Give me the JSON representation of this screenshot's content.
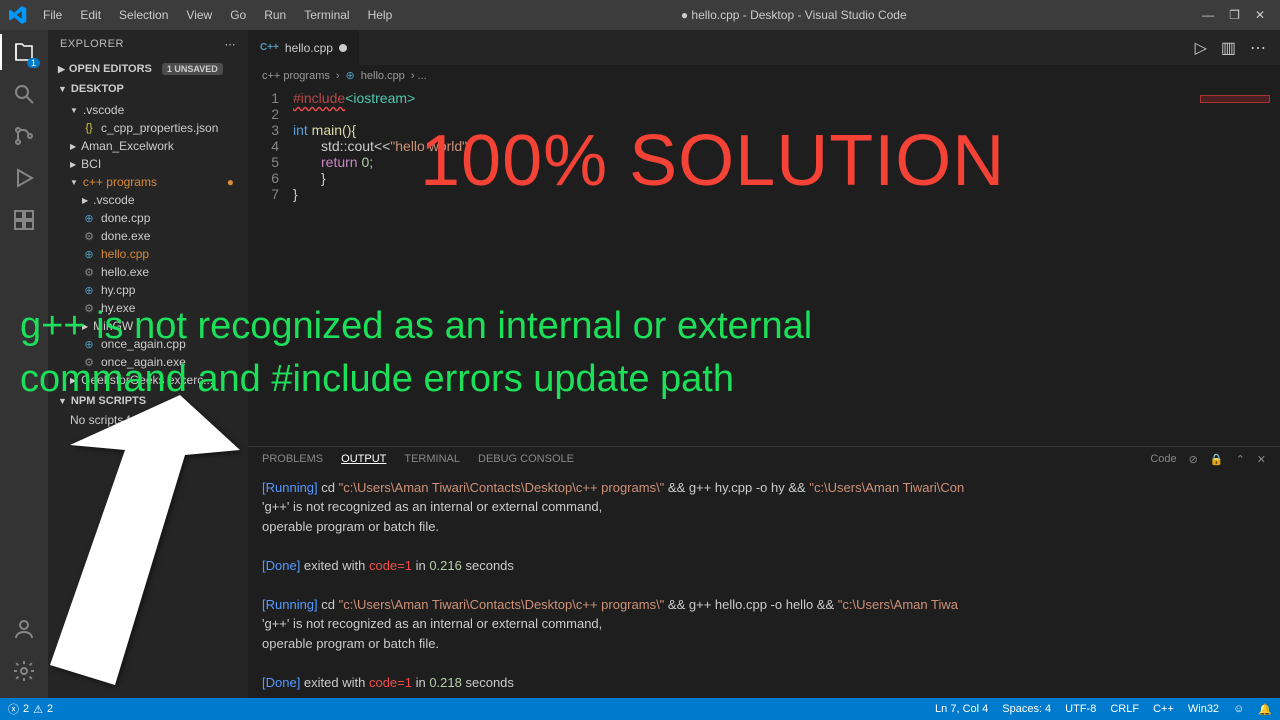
{
  "titlebar": {
    "menus": [
      "File",
      "Edit",
      "Selection",
      "View",
      "Go",
      "Run",
      "Terminal",
      "Help"
    ],
    "title": "● hello.cpp - Desktop - Visual Studio Code"
  },
  "sidebar": {
    "header": "EXPLORER",
    "openEditors": "OPEN EDITORS",
    "unsaved": "1 UNSAVED",
    "root": "DESKTOP",
    "items": [
      {
        "label": ".vscode",
        "type": "folder",
        "indent": 0,
        "open": true
      },
      {
        "label": "c_cpp_properties.json",
        "type": "json",
        "indent": 1
      },
      {
        "label": "Aman_Excelwork",
        "type": "folder",
        "indent": 0
      },
      {
        "label": "BCI",
        "type": "folder",
        "indent": 0
      },
      {
        "label": "c++ programs",
        "type": "folder",
        "indent": 0,
        "open": true,
        "modified": true,
        "orange": true
      },
      {
        "label": ".vscode",
        "type": "folder",
        "indent": 1
      },
      {
        "label": "done.cpp",
        "type": "cpp",
        "indent": 1
      },
      {
        "label": "done.exe",
        "type": "exe",
        "indent": 1
      },
      {
        "label": "hello.cpp",
        "type": "cpp",
        "indent": 1,
        "orange": true
      },
      {
        "label": "hello.exe",
        "type": "exe",
        "indent": 1
      },
      {
        "label": "hy.cpp",
        "type": "cpp",
        "indent": 1
      },
      {
        "label": "hy.exe",
        "type": "exe",
        "indent": 1
      },
      {
        "label": "MinGW",
        "type": "folder",
        "indent": 1
      },
      {
        "label": "once_again.cpp",
        "type": "cpp",
        "indent": 1
      },
      {
        "label": "once_again.exe",
        "type": "exe",
        "indent": 1
      },
      {
        "label": "GeeksforGeeks excerc...",
        "type": "folder",
        "indent": 0
      }
    ],
    "npm": "NPM SCRIPTS",
    "npmMsg": "No scripts found."
  },
  "tab": {
    "name": "hello.cpp",
    "icon": "C++"
  },
  "breadcrumb": {
    "folder": "c++ programs",
    "file": "hello.cpp"
  },
  "code": {
    "l1a": "#include",
    "l1b": "<iostream>",
    "l3a": "int",
    "l3b": " main(){",
    "l4a": "std::cout<<",
    "l4b": "\"hello world\"",
    "l4c": ";",
    "l5a": "return",
    "l5b": " 0;",
    "l6": "}",
    "l7": "} "
  },
  "panel": {
    "tabs": [
      "PROBLEMS",
      "OUTPUT",
      "TERMINAL",
      "DEBUG CONSOLE"
    ],
    "selector": "Code",
    "run1": "[Running]",
    "cmd1": " cd ",
    "path1a": "\"c:\\Users\\Aman Tiwari\\Contacts\\Desktop\\c++ programs\\\"",
    "cmd1b": " && g++ hy.cpp -o hy && ",
    "path1b": "\"c:\\Users\\Aman Tiwari\\Con",
    "err1a": "'g++' is not recognized as an internal or external command,",
    "err1b": "operable program or batch file.",
    "done1": "[Done]",
    "done1txt": " exited with ",
    "codekw": "code=1",
    "in1": " in ",
    "time1": "0.216",
    "sec": " seconds",
    "run2": "[Running]",
    "path2a": "\"c:\\Users\\Aman Tiwari\\Contacts\\Desktop\\c++ programs\\\"",
    "cmd2b": " && g++ hello.cpp -o hello && ",
    "path2b": "\"c:\\Users\\Aman Tiwa",
    "done2": "[Done]",
    "time2": "0.218"
  },
  "status": {
    "errors": "2",
    "warnings": "2",
    "pos": "Ln 7, Col 4",
    "spaces": "Spaces: 4",
    "enc": "UTF-8",
    "eol": "CRLF",
    "lang": "C++",
    "os": "Win32"
  },
  "overlay": {
    "red": "100% SOLUTION",
    "green1": "g++ is not recognized as an internal or external",
    "green2": "command and #include errors update path"
  }
}
